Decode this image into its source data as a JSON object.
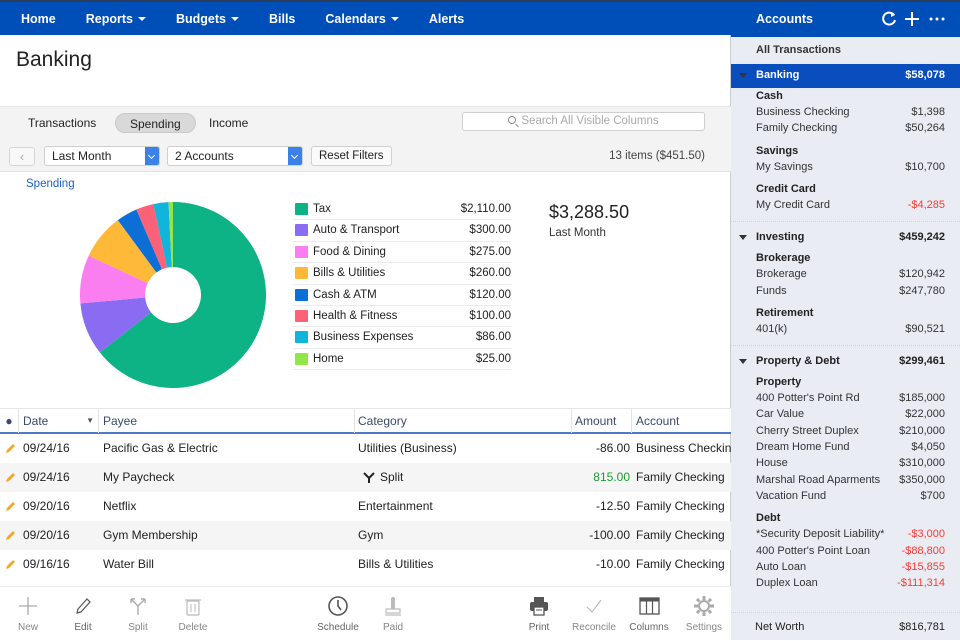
{
  "nav": {
    "items": [
      {
        "label": "Home",
        "dropdown": false
      },
      {
        "label": "Reports",
        "dropdown": true
      },
      {
        "label": "Budgets",
        "dropdown": true
      },
      {
        "label": "Bills",
        "dropdown": false
      },
      {
        "label": "Calendars",
        "dropdown": true
      },
      {
        "label": "Alerts",
        "dropdown": false
      }
    ]
  },
  "page": {
    "title": "Banking"
  },
  "tabs": [
    {
      "label": "Transactions",
      "active": false
    },
    {
      "label": "Spending",
      "active": true
    },
    {
      "label": "Income",
      "active": false
    }
  ],
  "search": {
    "placeholder": "Search All Visible Columns"
  },
  "filters": {
    "back_icon": "chevron-left-icon",
    "period": "Last Month",
    "accounts": "2 Accounts",
    "reset_label": "Reset Filters",
    "item_count": "13 items ($451.50)"
  },
  "spending": {
    "link_label": "Spending",
    "total": "$3,288.50",
    "total_label": "Last Month"
  },
  "chart_data": {
    "type": "pie",
    "title": "Spending",
    "donut": true,
    "categories": [
      "Tax",
      "Auto & Transport",
      "Food & Dining",
      "Bills & Utilities",
      "Cash & ATM",
      "Health & Fitness",
      "Business Expenses",
      "Home"
    ],
    "values": [
      2110.0,
      300.0,
      275.0,
      260.0,
      120.0,
      100.0,
      86.0,
      25.0
    ],
    "labels": [
      "$2,110.00",
      "$300.00",
      "$275.00",
      "$260.00",
      "$120.00",
      "$100.00",
      "$86.00",
      "$25.00"
    ],
    "colors": [
      "#0db384",
      "#8a6cf2",
      "#fa7ef0",
      "#ffb938",
      "#0b6fd6",
      "#fb6278",
      "#11b5dc",
      "#93e64a"
    ],
    "total": 3288.5,
    "legend": "right"
  },
  "table": {
    "columns": [
      "Date",
      "Payee",
      "Category",
      "Amount",
      "Account"
    ],
    "rows": [
      {
        "date": "09/24/16",
        "payee": "Pacific Gas & Electric",
        "category": "Utilities (Business)",
        "split": false,
        "amount": "-86.00",
        "positive": false,
        "account": "Business Checking"
      },
      {
        "date": "09/24/16",
        "payee": "My Paycheck",
        "category": "Split",
        "split": true,
        "amount": "815.00",
        "positive": true,
        "account": "Family Checking"
      },
      {
        "date": "09/20/16",
        "payee": "Netflix",
        "category": "Entertainment",
        "split": false,
        "amount": "-12.50",
        "positive": false,
        "account": "Family Checking"
      },
      {
        "date": "09/20/16",
        "payee": "Gym Membership",
        "category": "Gym",
        "split": false,
        "amount": "-100.00",
        "positive": false,
        "account": "Family Checking"
      },
      {
        "date": "09/16/16",
        "payee": "Water Bill",
        "category": "Bills & Utilities",
        "split": false,
        "amount": "-10.00",
        "positive": false,
        "account": "Family Checking"
      }
    ]
  },
  "toolbar": {
    "new": "New",
    "edit": "Edit",
    "split": "Split",
    "delete": "Delete",
    "schedule": "Schedule",
    "paid": "Paid",
    "print": "Print",
    "reconcile": "Reconcile",
    "columns": "Columns",
    "settings": "Settings"
  },
  "sidebar": {
    "title": "Accounts",
    "all_transactions": "All Transactions",
    "groups": [
      {
        "label": "Banking",
        "value": "$58,078",
        "active": true,
        "subgroups": [
          {
            "label": "Cash",
            "accounts": [
              {
                "name": "Business Checking",
                "value": "$1,398"
              },
              {
                "name": "Family Checking",
                "value": "$50,264"
              }
            ]
          },
          {
            "label": "Savings",
            "accounts": [
              {
                "name": "My Savings",
                "value": "$10,700"
              }
            ]
          },
          {
            "label": "Credit Card",
            "accounts": [
              {
                "name": "My Credit Card",
                "value": "-$4,285",
                "negative": true
              }
            ]
          }
        ]
      },
      {
        "label": "Investing",
        "value": "$459,242",
        "active": false,
        "subgroups": [
          {
            "label": "Brokerage",
            "accounts": [
              {
                "name": "Brokerage",
                "value": "$120,942"
              },
              {
                "name": "Funds",
                "value": "$247,780"
              }
            ]
          },
          {
            "label": "Retirement",
            "accounts": [
              {
                "name": "401(k)",
                "value": "$90,521"
              }
            ]
          }
        ]
      },
      {
        "label": "Property & Debt",
        "value": "$299,461",
        "active": false,
        "subgroups": [
          {
            "label": "Property",
            "accounts": [
              {
                "name": "400 Potter's Point Rd",
                "value": "$185,000"
              },
              {
                "name": "Car Value",
                "value": "$22,000"
              },
              {
                "name": "Cherry Street Duplex",
                "value": "$210,000"
              },
              {
                "name": "Dream Home Fund",
                "value": "$4,050"
              },
              {
                "name": "House",
                "value": "$310,000"
              },
              {
                "name": "Marshal Road Aparments",
                "value": "$350,000"
              },
              {
                "name": "Vacation Fund",
                "value": "$700"
              }
            ]
          },
          {
            "label": "Debt",
            "accounts": [
              {
                "name": "*Security Deposit Liability*",
                "value": "-$3,000",
                "negative": true
              },
              {
                "name": "400 Potter's Point Loan",
                "value": "-$88,800",
                "negative": true
              },
              {
                "name": "Auto Loan",
                "value": "-$15,855",
                "negative": true
              },
              {
                "name": "Duplex Loan",
                "value": "-$111,314",
                "negative": true
              }
            ]
          }
        ]
      }
    ],
    "net_worth_label": "Net Worth",
    "net_worth_value": "$816,781"
  }
}
